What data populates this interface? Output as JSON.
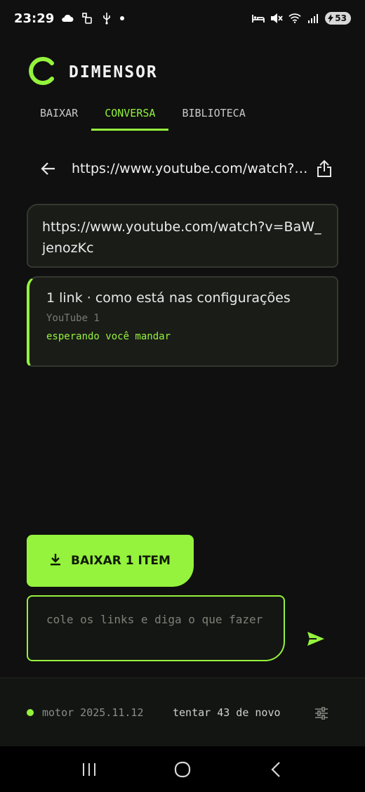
{
  "status_bar": {
    "time": "23:29",
    "battery": "53",
    "icons": [
      "cloud-icon",
      "usb-debug-icon",
      "usb-icon",
      "dot-icon",
      "bed-icon",
      "mute-icon",
      "wifi-icon",
      "signal-icon",
      "battery-icon"
    ]
  },
  "brand": {
    "name": "DIMENSOR",
    "logo": "c-logo-icon",
    "accent": "#95f23d"
  },
  "tabs": [
    {
      "label": "BAIXAR",
      "active": false
    },
    {
      "label": "CONVERSA",
      "active": true
    },
    {
      "label": "BIBLIOTECA",
      "active": false
    }
  ],
  "url_bar": {
    "url": "https://www.youtube.com/watch?v=BaW_jenozKc"
  },
  "user_message": {
    "text": "https://www.youtube.com/watch?v=BaW_jenozKc"
  },
  "reply": {
    "title": "1 link · como está nas configurações",
    "source": "YouTube 1",
    "status": "esperando você mandar"
  },
  "download_button": {
    "label": "BAIXAR 1 ITEM"
  },
  "input": {
    "placeholder": "cole os links e diga o que fazer"
  },
  "footer": {
    "engine": "motor 2025.11.12",
    "retry": "tentar 43 de novo"
  },
  "colors": {
    "background": "#0f100f",
    "accent": "#95f23d",
    "card": "#1a1c18"
  }
}
